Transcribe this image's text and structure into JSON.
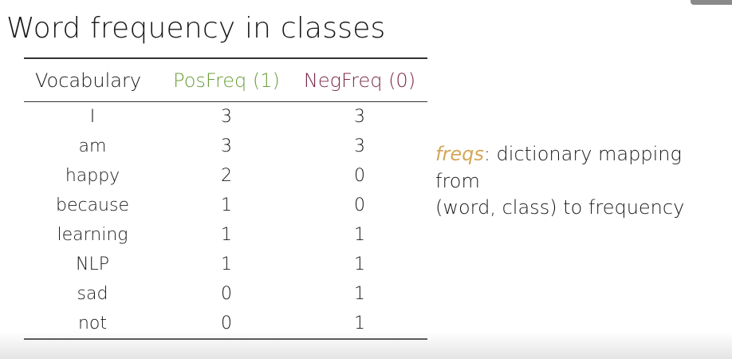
{
  "title": "Word frequency in classes",
  "table": {
    "headers": {
      "vocab": "Vocabulary",
      "pos": "PosFreq (1)",
      "neg": "NegFreq (0)"
    },
    "rows": [
      {
        "word": "I",
        "pos": "3",
        "neg": "3"
      },
      {
        "word": "am",
        "pos": "3",
        "neg": "3"
      },
      {
        "word": "happy",
        "pos": "2",
        "neg": "0"
      },
      {
        "word": "because",
        "pos": "1",
        "neg": "0"
      },
      {
        "word": "learning",
        "pos": "1",
        "neg": "1"
      },
      {
        "word": "NLP",
        "pos": "1",
        "neg": "1"
      },
      {
        "word": "sad",
        "pos": "0",
        "neg": "1"
      },
      {
        "word": "not",
        "pos": "0",
        "neg": "1"
      }
    ]
  },
  "note": {
    "term": "freqs",
    "rest_line1": ": dictionary mapping from",
    "line2": "(word, class) to frequency"
  },
  "colors": {
    "pos_header": "#6b9e3a",
    "neg_header": "#7a2a4a",
    "freqs_term": "#d4a85a"
  }
}
